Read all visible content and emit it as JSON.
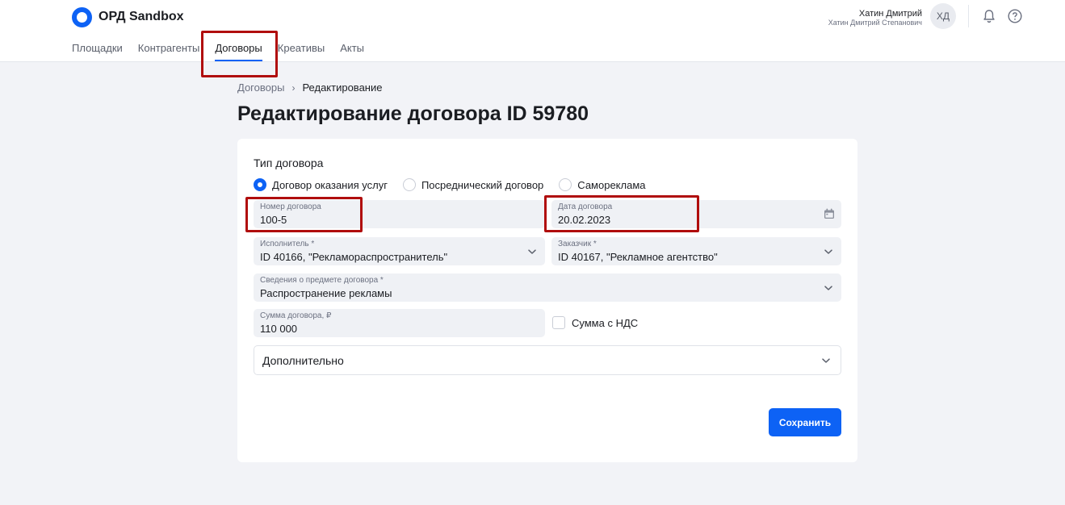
{
  "app": {
    "name": "ОРД Sandbox",
    "brand_color": "#0d62f5"
  },
  "nav": [
    {
      "label": "Площадки",
      "active": false
    },
    {
      "label": "Контрагенты",
      "active": false
    },
    {
      "label": "Договоры",
      "active": true
    },
    {
      "label": "Креативы",
      "active": false
    },
    {
      "label": "Акты",
      "active": false
    }
  ],
  "user": {
    "name": "Хатин Дмитрий",
    "full_name": "Хатин Дмитрий Степанович",
    "initials": "ХД"
  },
  "icons": {
    "notifications": "bell-icon",
    "help": "question-circle-icon",
    "calendar": "calendar-icon",
    "expand": "chevron-down-icon"
  },
  "breadcrumb": {
    "parent": "Договоры",
    "separator": "›",
    "current": "Редактирование"
  },
  "page": {
    "title": "Редактирование договора ID 59780"
  },
  "form": {
    "type_label": "Тип договора",
    "types": [
      {
        "label": "Договор оказания услуг",
        "selected": true
      },
      {
        "label": "Посреднический договор",
        "selected": false
      },
      {
        "label": "Самореклама",
        "selected": false
      }
    ],
    "number": {
      "label": "Номер договора",
      "value": "100-5"
    },
    "date": {
      "label": "Дата договора",
      "value": "20.02.2023"
    },
    "executor": {
      "label": "Исполнитель *",
      "value": "ID 40166, \"Рекламораспространитель\""
    },
    "customer": {
      "label": "Заказчик *",
      "value": "ID 40167, \"Рекламное агентство\""
    },
    "subject": {
      "label": "Сведения о предмете договора *",
      "value": "Распространение рекламы"
    },
    "amount": {
      "label": "Сумма договора, ₽",
      "value": "110 000"
    },
    "vat": {
      "label": "Сумма с НДС",
      "checked": false
    },
    "extra": {
      "label": "Дополнительно"
    },
    "save_label": "Сохранить"
  },
  "annotations": {
    "highlight_color": "#b00d0d"
  }
}
